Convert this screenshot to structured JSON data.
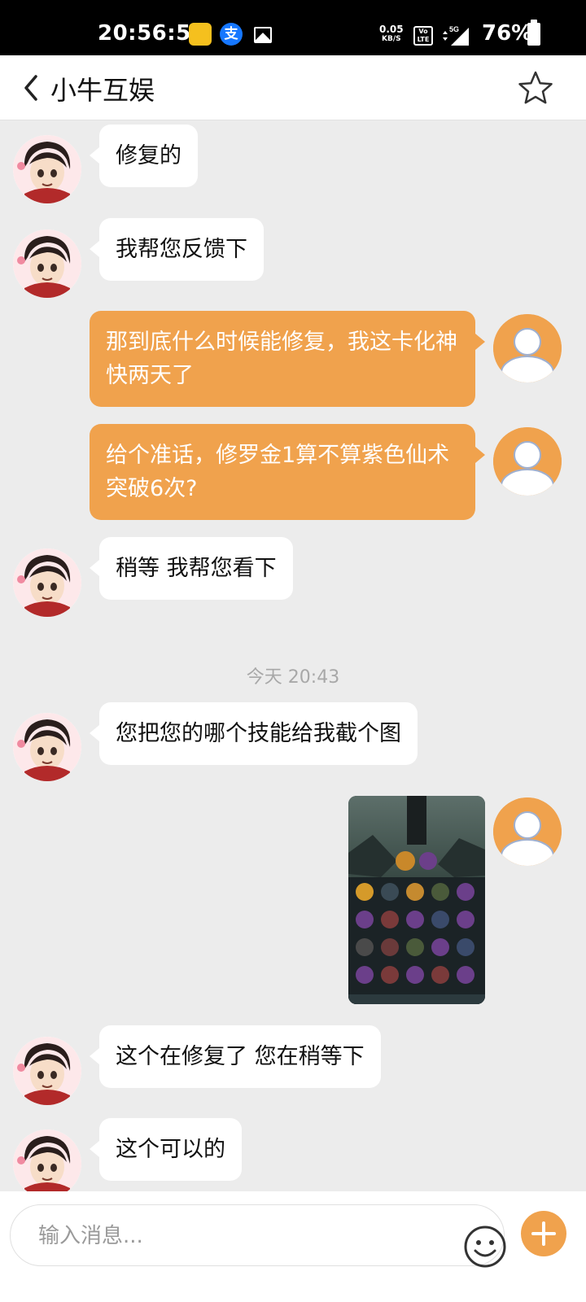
{
  "status_bar": {
    "time": "20:56:51",
    "net_speed_value": "0.05",
    "net_speed_unit": "KB/S",
    "volte_label": "Vo LTE",
    "signal_label": "5G",
    "battery_percent": "76%",
    "icons": [
      "app-notification-icon",
      "alipay-icon",
      "gallery-icon",
      "volte-icon",
      "signal-icon",
      "battery-icon"
    ]
  },
  "header": {
    "title": "小牛互娱",
    "back_icon": "chevron-left-icon",
    "favorite_icon": "star-icon"
  },
  "messages": [
    {
      "side": "in",
      "text": "修复的"
    },
    {
      "side": "in",
      "text": "我帮您反馈下"
    },
    {
      "side": "out",
      "text": "那到底什么时候能修复，我这卡化神快两天了"
    },
    {
      "side": "out",
      "text": "给个准话，修罗金1算不算紫色仙术突破6次?"
    },
    {
      "side": "in",
      "text": "稍等 我帮您看下"
    },
    {
      "type": "timestamp",
      "text": "今天 20:43"
    },
    {
      "side": "in",
      "text": "您把您的哪个技能给我截个图"
    },
    {
      "side": "out",
      "type": "image"
    },
    {
      "side": "in",
      "text": "这个在修复了 您在稍等下"
    },
    {
      "side": "in",
      "text": "这个可以的"
    }
  ],
  "input": {
    "placeholder": "输入消息...",
    "value": ""
  },
  "colors": {
    "accent": "#f0a24d",
    "background": "#ececec",
    "incoming_bubble": "#ffffff",
    "status_bar": "#000000"
  }
}
